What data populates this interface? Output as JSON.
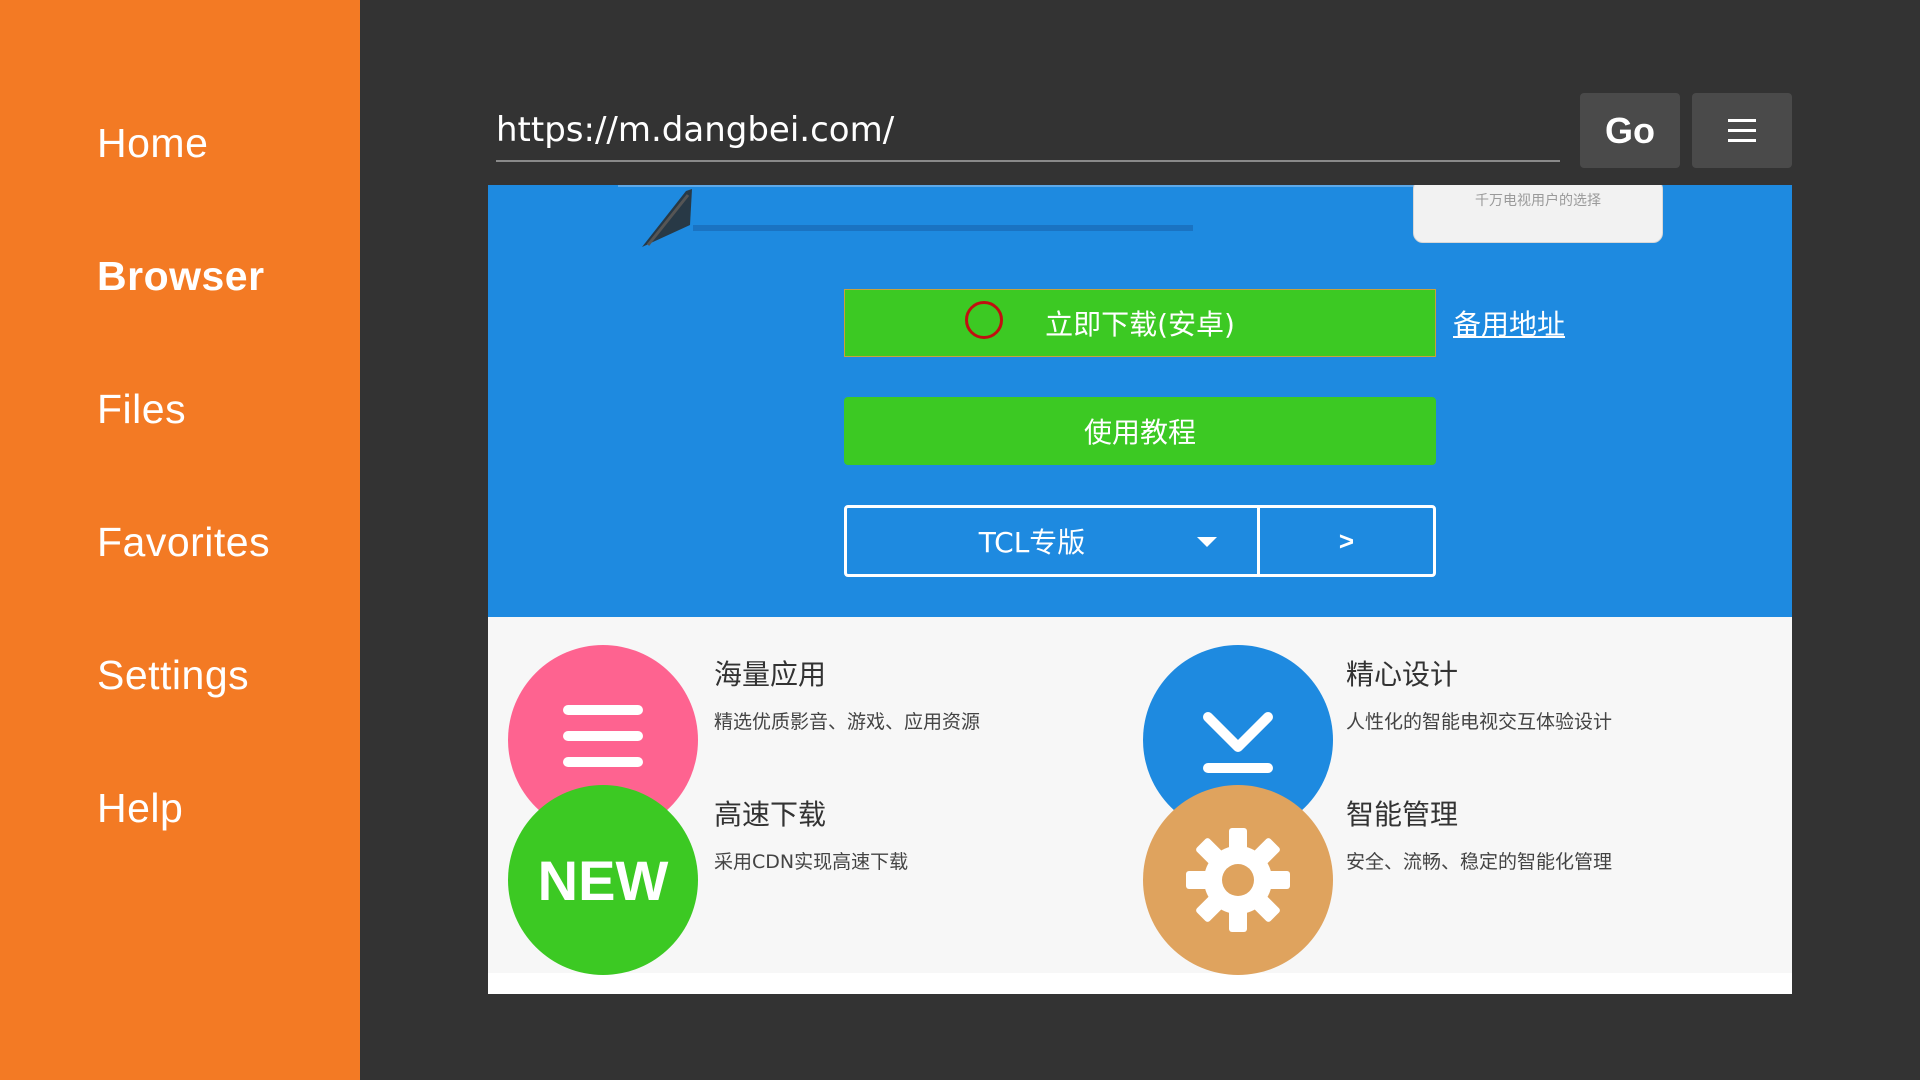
{
  "sidebar": {
    "items": [
      {
        "label": "Home",
        "active": false
      },
      {
        "label": "Browser",
        "active": true
      },
      {
        "label": "Files",
        "active": false
      },
      {
        "label": "Favorites",
        "active": false
      },
      {
        "label": "Settings",
        "active": false
      },
      {
        "label": "Help",
        "active": false
      }
    ]
  },
  "toolbar": {
    "url_value": "https://m.dangbei.com/",
    "go_label": "Go",
    "menu_icon": "hamburger-menu-icon"
  },
  "page": {
    "phone_caption": "千万电视用户的选择",
    "download_button": "立即下载(安卓)",
    "backup_link": "备用地址",
    "tutorial_button": "使用教程",
    "version_select": "TCL专版",
    "version_go": ">",
    "features": [
      {
        "title": "海量应用",
        "desc": "精选优质影音、游戏、应用资源",
        "icon": "list-icon",
        "color": "#fe6390"
      },
      {
        "title": "精心设计",
        "desc": "人性化的智能电视交互体验设计",
        "icon": "download-icon",
        "color": "#1e8ae0"
      },
      {
        "title": "高速下载",
        "desc": "采用CDN实现高速下载",
        "icon": "new-badge-icon",
        "badge": "NEW",
        "color": "#3cc923"
      },
      {
        "title": "智能管理",
        "desc": "安全、流畅、稳定的智能化管理",
        "icon": "gear-icon",
        "color": "#dfa35e"
      }
    ]
  },
  "colors": {
    "sidebar": "#f37a24",
    "background": "#333333",
    "hero": "#1e8ae0",
    "button_green": "#3cc923"
  }
}
